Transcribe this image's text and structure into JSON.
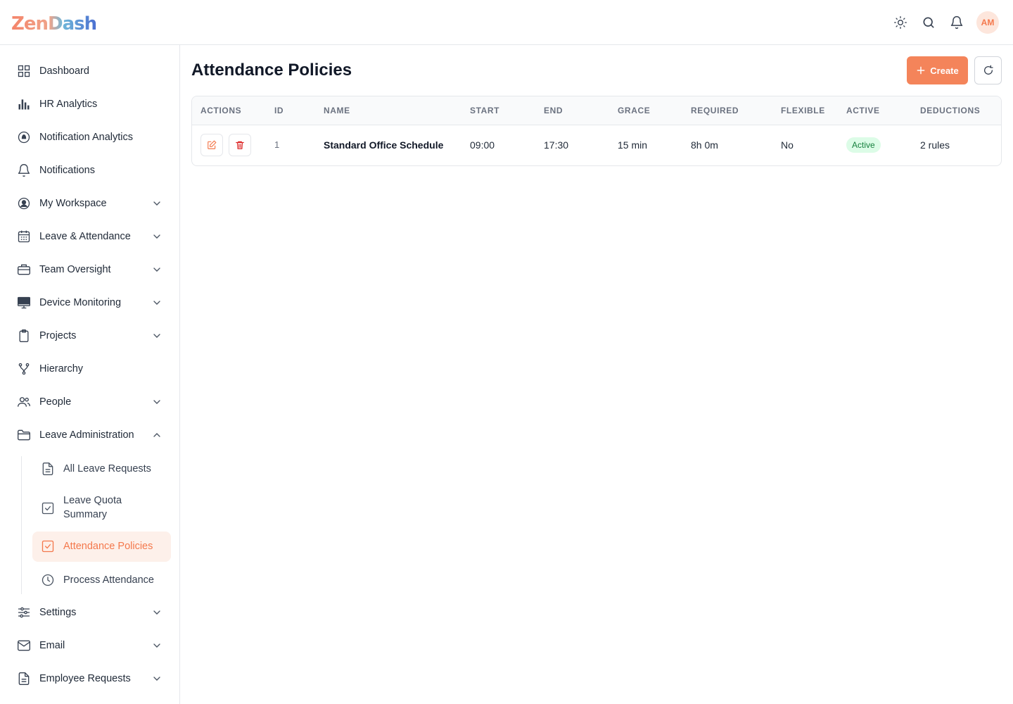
{
  "app": {
    "logo_text_1": "Zen",
    "logo_text_2": "Dash",
    "avatar_initials": "AM"
  },
  "topbar": {
    "icons": [
      "sun-icon",
      "search-icon",
      "bell-icon"
    ]
  },
  "sidebar": {
    "items": [
      {
        "label": "Dashboard",
        "icon": "grid-icon",
        "expandable": false
      },
      {
        "label": "HR Analytics",
        "icon": "bar-chart-icon",
        "expandable": false
      },
      {
        "label": "Notification Analytics",
        "icon": "notification-analytics-icon",
        "expandable": false
      },
      {
        "label": "Notifications",
        "icon": "bell-icon",
        "expandable": false
      },
      {
        "label": "My Workspace",
        "icon": "user-circle-icon",
        "expandable": true
      },
      {
        "label": "Leave & Attendance",
        "icon": "calendar-icon",
        "expandable": true
      },
      {
        "label": "Team Oversight",
        "icon": "briefcase-icon",
        "expandable": true
      },
      {
        "label": "Device Monitoring",
        "icon": "monitor-icon",
        "expandable": true
      },
      {
        "label": "Projects",
        "icon": "clipboard-icon",
        "expandable": true
      },
      {
        "label": "Hierarchy",
        "icon": "hierarchy-icon",
        "expandable": false
      },
      {
        "label": "People",
        "icon": "people-icon",
        "expandable": true
      },
      {
        "label": "Leave Administration",
        "icon": "folder-icon",
        "expandable": true,
        "expanded": true
      },
      {
        "label": "Settings",
        "icon": "sliders-icon",
        "expandable": true
      },
      {
        "label": "Email",
        "icon": "mail-icon",
        "expandable": true
      },
      {
        "label": "Employee Requests",
        "icon": "document-icon",
        "expandable": true
      }
    ],
    "subitems": [
      {
        "label": "All Leave Requests",
        "icon": "document-icon"
      },
      {
        "label": "Leave Quota Summary",
        "label_line1": "Leave Quota",
        "label_line2": "Summary",
        "icon": "check-square-icon"
      },
      {
        "label": "Attendance Policies",
        "icon": "check-square-icon",
        "active": true
      },
      {
        "label": "Process Attendance",
        "icon": "clock-icon"
      }
    ]
  },
  "main": {
    "title": "Attendance Policies",
    "create_label": "Create",
    "table": {
      "columns": [
        "ACTIONS",
        "ID",
        "NAME",
        "START",
        "END",
        "GRACE",
        "REQUIRED",
        "FLEXIBLE",
        "ACTIVE",
        "DEDUCTIONS"
      ],
      "rows": [
        {
          "id": "1",
          "name": "Standard Office Schedule",
          "start": "09:00",
          "end": "17:30",
          "grace": "15 min",
          "required": "8h 0m",
          "flexible": "No",
          "active": "Active",
          "deductions": "2 rules"
        }
      ]
    }
  },
  "colors": {
    "accent": "#f4784c",
    "active_badge_bg": "#dcfce7",
    "active_badge_text": "#15803d"
  }
}
